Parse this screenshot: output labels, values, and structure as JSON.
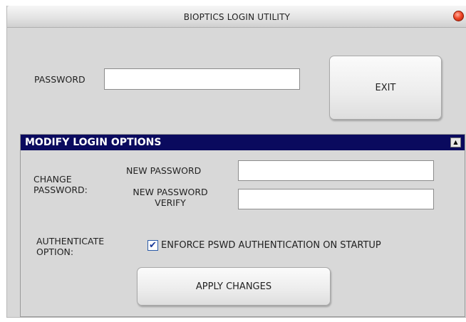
{
  "window": {
    "title": "BIOPTICS LOGIN UTILITY"
  },
  "login": {
    "password_label": "PASSWORD",
    "password_value": "",
    "exit_label": "EXIT"
  },
  "modify": {
    "title": "MODIFY LOGIN OPTIONS",
    "collapse_glyph": "▲",
    "change_password_label_line1": "CHANGE",
    "change_password_label_line2": "PASSWORD:",
    "new_password_label": "NEW PASSWORD",
    "new_password_value": "",
    "verify_label_line1": "NEW PASSWORD",
    "verify_label_line2": "VERIFY",
    "verify_value": "",
    "authenticate_label_line1": "AUTHENTICATE",
    "authenticate_label_line2": "OPTION:",
    "enforce_checked": true,
    "enforce_check_glyph": "✔",
    "enforce_label": "ENFORCE PSWD AUTHENTICATION ON STARTUP",
    "apply_label": "APPLY CHANGES"
  },
  "colors": {
    "header_bg": "#0a0a5e",
    "window_bg": "#d8d8d8",
    "close_button": "#f04a2a"
  }
}
